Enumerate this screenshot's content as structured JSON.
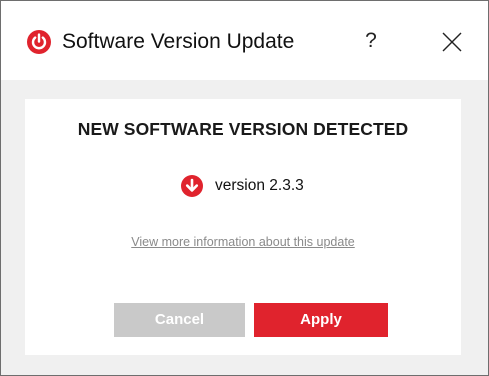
{
  "window": {
    "title": "Software Version Update",
    "help_label": "?",
    "close_icon": "close-icon",
    "logo_icon": "power-logo-icon"
  },
  "content": {
    "heading": "NEW SOFTWARE VERSION DETECTED",
    "version_icon": "download-arrow-icon",
    "version_text": "version 2.3.3",
    "info_link": "View more information about this update"
  },
  "buttons": {
    "cancel": "Cancel",
    "apply": "Apply"
  },
  "colors": {
    "accent": "#e0232d",
    "disabled_button": "#c9c9c9",
    "background": "#f0f0f0",
    "link": "#8a8a8a"
  }
}
